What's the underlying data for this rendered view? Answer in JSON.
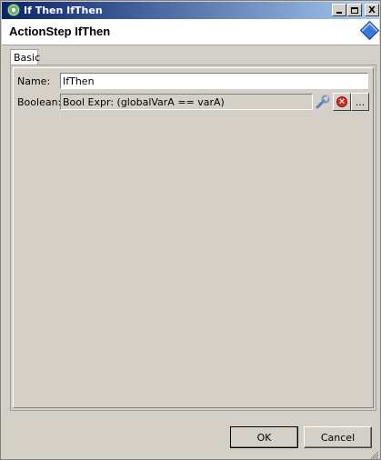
{
  "window": {
    "title": "If Then IfThen",
    "minimize_icon": "minimize-icon",
    "maximize_icon": "maximize-icon",
    "close_label": "X"
  },
  "header": {
    "title": "ActionStep IfThen",
    "icon": "diamond-icon",
    "accent": "#3b78d8"
  },
  "tabs": [
    {
      "label": "Basic",
      "selected": true
    }
  ],
  "form": {
    "name_label": "Name:",
    "name_value": "IfThen",
    "boolean_label": "Boolean:",
    "boolean_value": "Bool Expr: (globalVarA == varA)",
    "edit_icon": "wrench-icon",
    "clear_icon": "clear-icon",
    "browse_label": "..."
  },
  "buttons": {
    "ok": "OK",
    "cancel": "Cancel"
  }
}
